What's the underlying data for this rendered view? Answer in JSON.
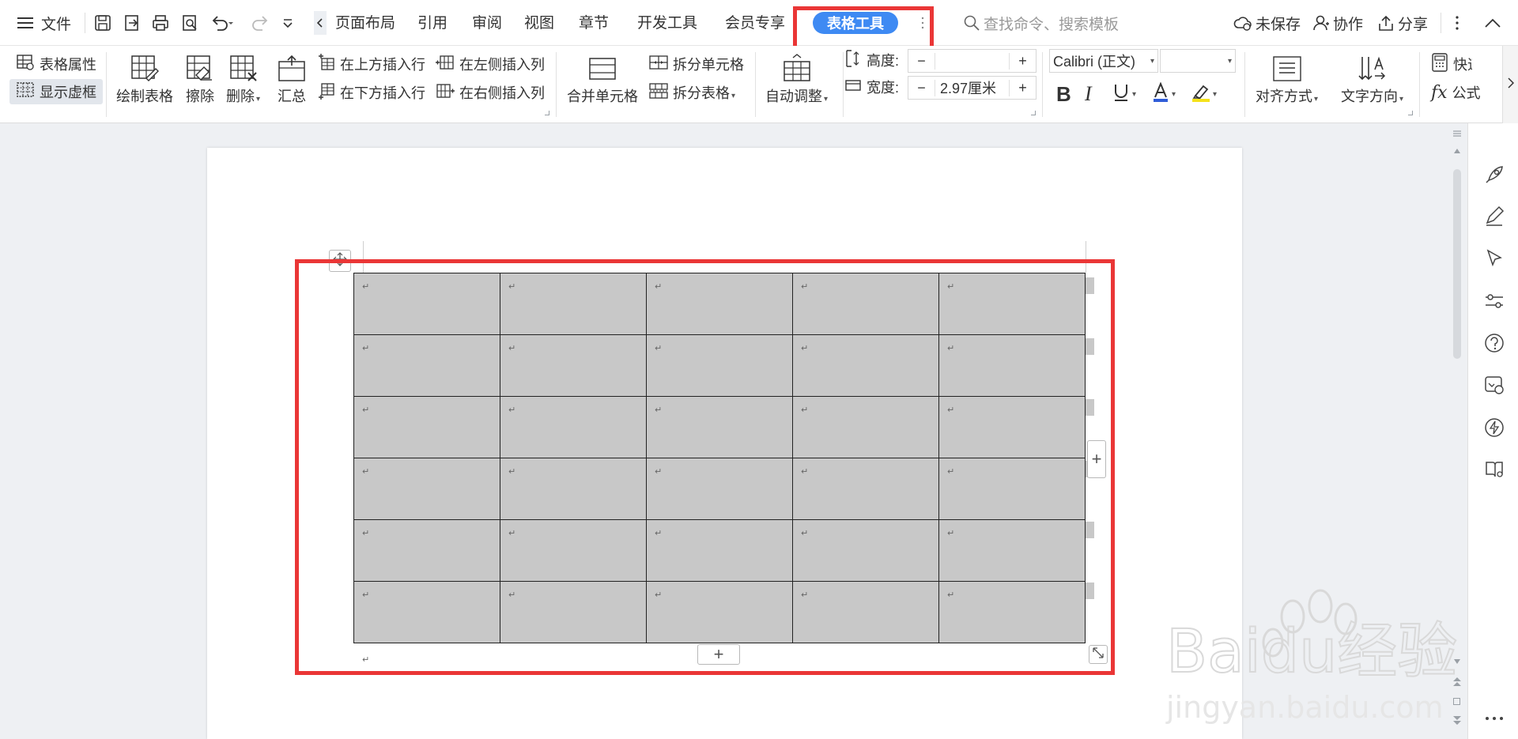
{
  "topbar": {
    "menu_label": "文件",
    "tabs": [
      {
        "label": "页面布局"
      },
      {
        "label": "引用"
      },
      {
        "label": "审阅"
      },
      {
        "label": "视图"
      },
      {
        "label": "章节"
      },
      {
        "label": "开发工具"
      },
      {
        "label": "会员专享"
      }
    ],
    "active_tab": "表格工具",
    "search_placeholder": "查找命令、搜索模板",
    "unsaved_label": "未保存",
    "collab_label": "协作",
    "share_label": "分享"
  },
  "ribbon": {
    "table_props": "表格属性",
    "show_gridlines": "显示虚框",
    "draw_table": "绘制表格",
    "erase": "擦除",
    "delete": "删除",
    "summary": "汇总",
    "insert_row_above": "在上方插入行",
    "insert_row_below": "在下方插入行",
    "insert_col_left": "在左侧插入列",
    "insert_col_right": "在右侧插入列",
    "merge_cells": "合并单元格",
    "split_cells": "拆分单元格",
    "split_table": "拆分表格",
    "auto_adjust": "自动调整",
    "height_label": "高度:",
    "height_value": "",
    "width_label": "宽度:",
    "width_value": "2.97厘米",
    "minus": "−",
    "plus": "+",
    "font_name": "Calibri (正文)",
    "font_size": "",
    "align": "对齐方式",
    "text_direction": "文字方向",
    "quick_calc": "快速计算",
    "formula": "公式"
  },
  "document": {
    "table": {
      "rows": 6,
      "cols": 5,
      "cells": [
        [
          "↵",
          "↵",
          "↵",
          "↵",
          "↵"
        ],
        [
          "↵",
          "↵",
          "↵",
          "↵",
          "↵"
        ],
        [
          "↵",
          "↵",
          "↵",
          "↵",
          "↵"
        ],
        [
          "↵",
          "↵",
          "↵",
          "↵",
          "↵"
        ],
        [
          "↵",
          "↵",
          "↵",
          "↵",
          "↵"
        ],
        [
          "↵",
          "↵",
          "↵",
          "↵",
          "↵"
        ]
      ]
    },
    "paragraph_mark": "↵",
    "add_row": "+",
    "add_col": "+"
  },
  "colors": {
    "accent": "#3e8af3",
    "highlight": "#ea3636",
    "cell_fill": "#c8c8c8"
  },
  "watermark": {
    "brand": "Baidu经验",
    "url": "jingyan.baidu.com"
  }
}
